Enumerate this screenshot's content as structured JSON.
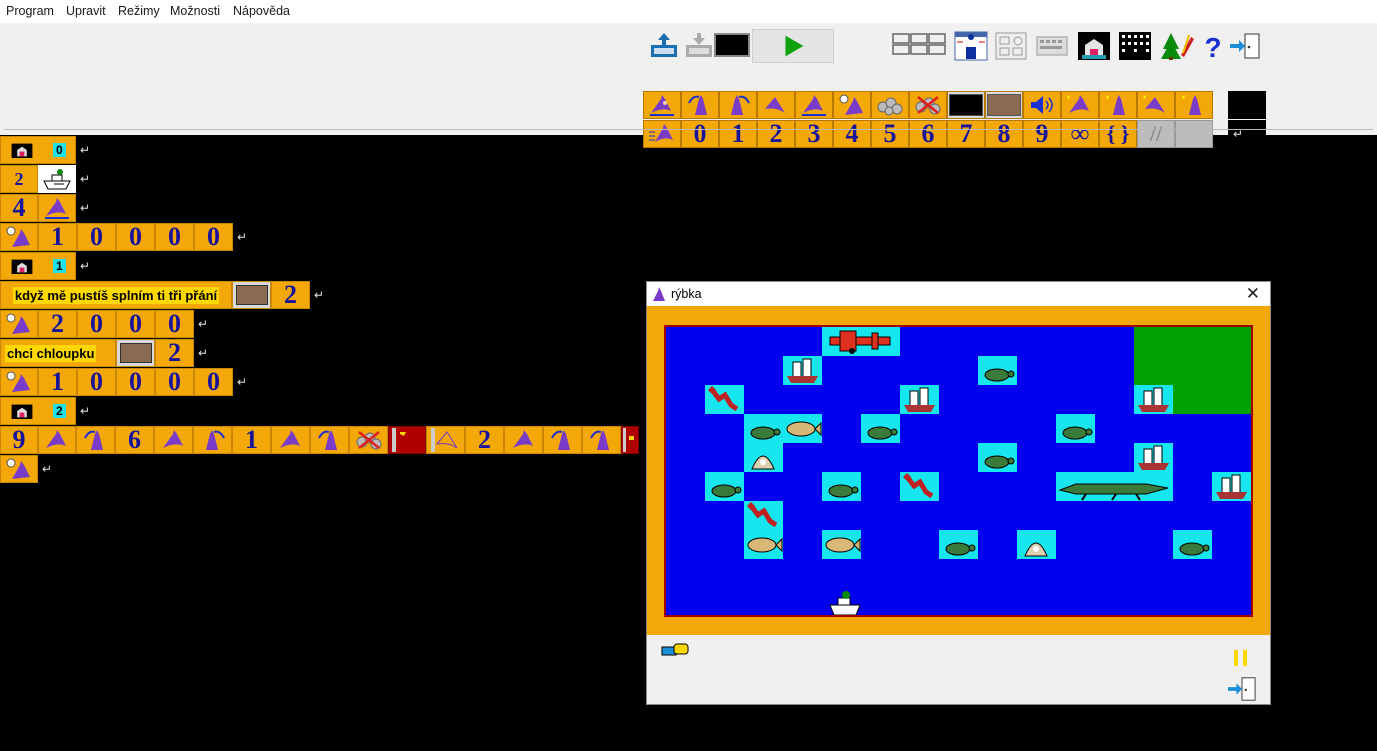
{
  "menu": [
    "Program",
    "Upravit",
    "Režimy",
    "Možnosti",
    "Nápověda"
  ],
  "palette": {
    "row2_numbers": [
      "0",
      "1",
      "2",
      "3",
      "4",
      "5",
      "6",
      "7",
      "8",
      "9",
      "∞",
      "{ }",
      "//"
    ]
  },
  "program": {
    "row1_num": "0",
    "row2_num": "2",
    "row3_num": "4",
    "row4_digits": [
      "1",
      "0",
      "0",
      "0",
      "0"
    ],
    "row5_num": "1",
    "row6_text": "když mě pustíš splním ti tři přání",
    "row6_num": "2",
    "row7_digits": [
      "2",
      "0",
      "0",
      "0"
    ],
    "row8_text": "chci chloupku",
    "row8_num": "2",
    "row9_digits": [
      "1",
      "0",
      "0",
      "0",
      "0"
    ],
    "row10_num": "2",
    "row11_nums": [
      "9",
      "6",
      "1",
      "2"
    ]
  },
  "window": {
    "title": "rýbka"
  },
  "colors": {
    "block": "#f3a808",
    "sea": "#0000ee",
    "tile": "#17e6ef",
    "land": "#00a000",
    "digit": "#17139a"
  }
}
